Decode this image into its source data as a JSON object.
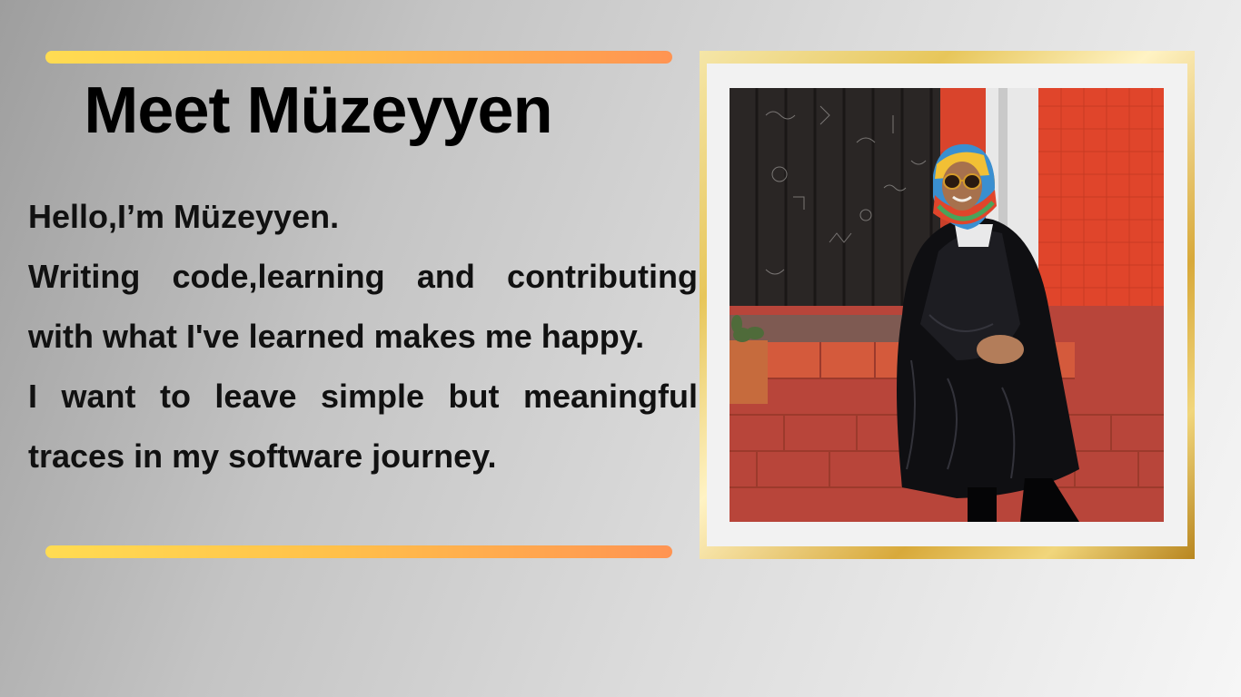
{
  "slide": {
    "title": "Meet Müzeyyen",
    "paragraphs": {
      "greeting": "Hello,I’m Müzeyyen.",
      "line1": "Writing code,learning and contributing",
      "line2": "with what I've learned makes me happy.",
      "line3": "I want to leave simple but meaningful",
      "line4": "traces in my software journey."
    },
    "photo_icon": "portrait-photo"
  },
  "colors": {
    "accent_start": "#ffdc52",
    "accent_end": "#ff9452",
    "frame_gold": "#e7c65a"
  }
}
